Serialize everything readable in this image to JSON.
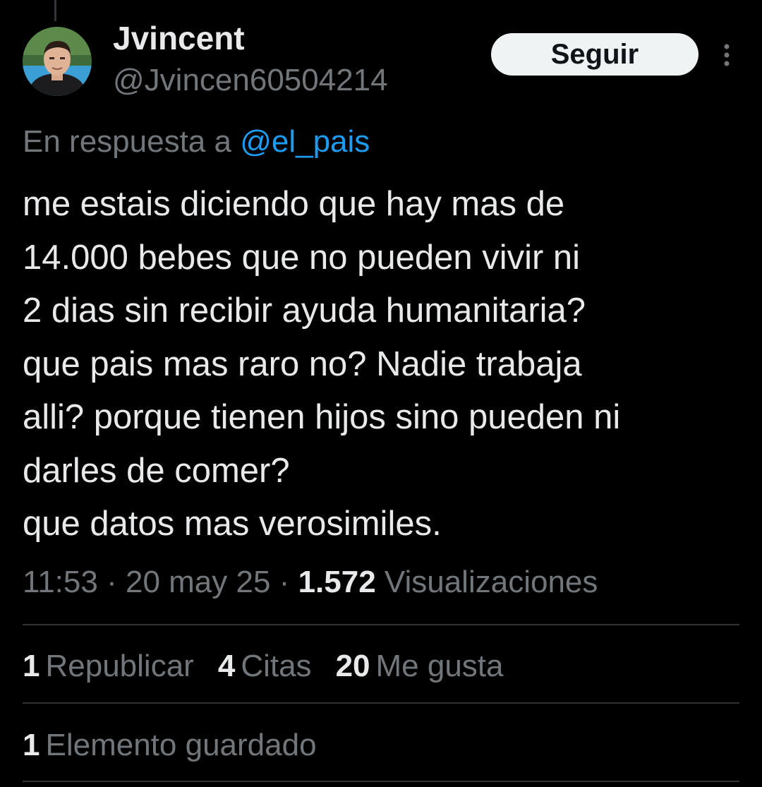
{
  "author": {
    "display_name": "Jvincent",
    "handle": "@Jvincen60504214",
    "avatar_icon": "avatar-photo"
  },
  "follow_button": {
    "label": "Seguir"
  },
  "more_icon": "more-vertical-icon",
  "reply_context": {
    "prefix": "En respuesta a",
    "mention": "@el_pais"
  },
  "tweet": {
    "lines": [
      "me estais diciendo que hay mas de",
      "14.000 bebes que no pueden vivir ni",
      "2 dias sin recibir ayuda humanitaria?",
      "que pais mas raro no? Nadie trabaja",
      "alli? porque tienen hijos sino pueden ni",
      "darles de comer?",
      "que datos mas verosimiles."
    ]
  },
  "meta": {
    "time": "11:53",
    "separator": "·",
    "date": "20 may 25",
    "views_count": "1.572",
    "views_label": "Visualizaciones"
  },
  "stats": {
    "reposts": {
      "count": "1",
      "label": "Republicar"
    },
    "quotes": {
      "count": "4",
      "label": "Citas"
    },
    "likes": {
      "count": "20",
      "label": "Me gusta"
    }
  },
  "bookmarks": {
    "count": "1",
    "label": "Elemento guardado"
  },
  "colors": {
    "background": "#000000",
    "text_primary": "#e7e9ea",
    "text_secondary": "#71767b",
    "link": "#1d9bf0",
    "divider": "#2f3336",
    "button_bg": "#eff3f4"
  }
}
